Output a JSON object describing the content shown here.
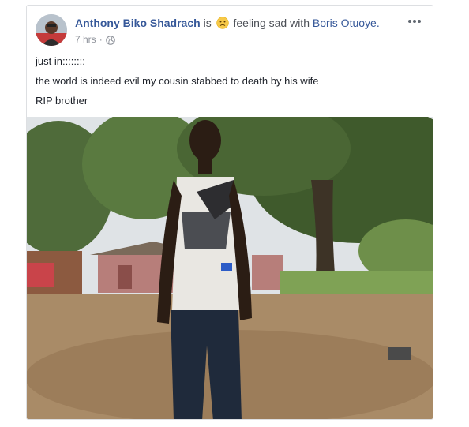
{
  "post": {
    "author": "Anthony Biko Shadrach",
    "is_word": "is",
    "feeling_text": "feeling sad with",
    "tagged_user": "Boris Otuoye.",
    "timestamp": "7 hrs",
    "separator": "·",
    "lines": [
      "just in::::::::",
      "the world is indeed evil my cousin stabbed to death by his wife",
      "RIP brother"
    ]
  },
  "icons": {
    "feeling": "sad-face-icon",
    "privacy": "globe-icon",
    "more": "more-options-icon"
  },
  "colors": {
    "link": "#365899",
    "meta": "#90949c",
    "border": "#dddfe2"
  }
}
